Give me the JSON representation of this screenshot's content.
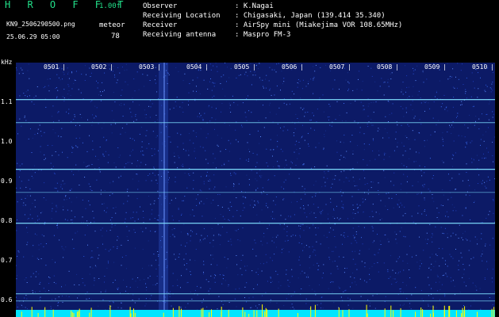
{
  "header": {
    "app_title": "H R O F F T",
    "version": "1.00f",
    "filename": "KN9_2506290500.png",
    "timestamp": "25.06.29 05:00",
    "meteor_label": "meteor",
    "meteor_count": "78"
  },
  "info": [
    {
      "key": "Observer",
      "value": ": K.Nagai"
    },
    {
      "key": "Receiving Location",
      "value": ": Chigasaki, Japan (139.414 35.340)"
    },
    {
      "key": "Receiver",
      "value": ": AirSpy mini (Miakejima VOR 108.65MHz)"
    },
    {
      "key": "Receiving antenna",
      "value": ": Maspro FM-3"
    }
  ],
  "axis": {
    "y_unit": "kHz",
    "time_ticks": [
      "0501",
      "0502",
      "0503",
      "0504",
      "0505",
      "0506",
      "0507",
      "0508",
      "0509",
      "0510"
    ],
    "freq_ticks": [
      "1.1",
      "1.0",
      "0.9",
      "0.8",
      "0.7",
      "0.6"
    ]
  },
  "colors": {
    "background": "#000000",
    "plot_noise": "#0c1a66",
    "title_green": "#22e08a",
    "signal_line": "#7fe0ff",
    "bottom_bar": "#00e5ff",
    "spike": "#ffff00"
  }
}
